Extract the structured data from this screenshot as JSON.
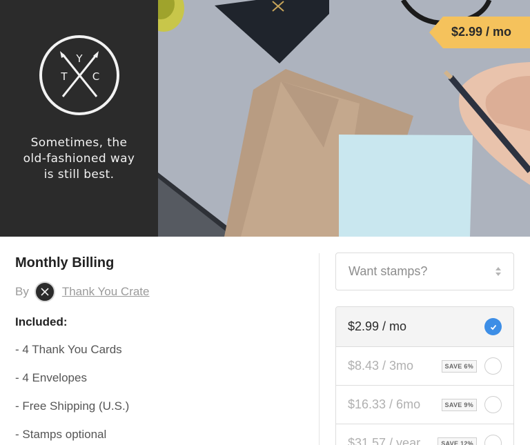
{
  "hero": {
    "tagline_lines": [
      "Sometimes, the",
      "old-fashioned way",
      "is still best."
    ],
    "logo_letters": {
      "top": "Y",
      "left": "T",
      "right": "C"
    },
    "price_tag": "$2.99 / mo",
    "colors": {
      "brand_panel": "#2b2b2b",
      "price_tag": "#f5c25c"
    }
  },
  "product": {
    "title": "Monthly Billing",
    "by_label": "By",
    "seller_name": "Thank You Crate",
    "included_label": "Included:",
    "features": [
      "- 4 Thank You Cards",
      "- 4 Envelopes",
      "- Free Shipping (U.S.)",
      "- Stamps optional"
    ]
  },
  "stamps_select": {
    "placeholder": "Want stamps?"
  },
  "plans": [
    {
      "price": "$2.99 / mo",
      "badge": "",
      "selected": true
    },
    {
      "price": "$8.43 / 3mo",
      "badge": "SAVE 6%",
      "selected": false
    },
    {
      "price": "$16.33 / 6mo",
      "badge": "SAVE 9%",
      "selected": false
    },
    {
      "price": "$31.57 / year",
      "badge": "SAVE 12%",
      "selected": false
    }
  ],
  "accent_color": "#3d8ee6"
}
